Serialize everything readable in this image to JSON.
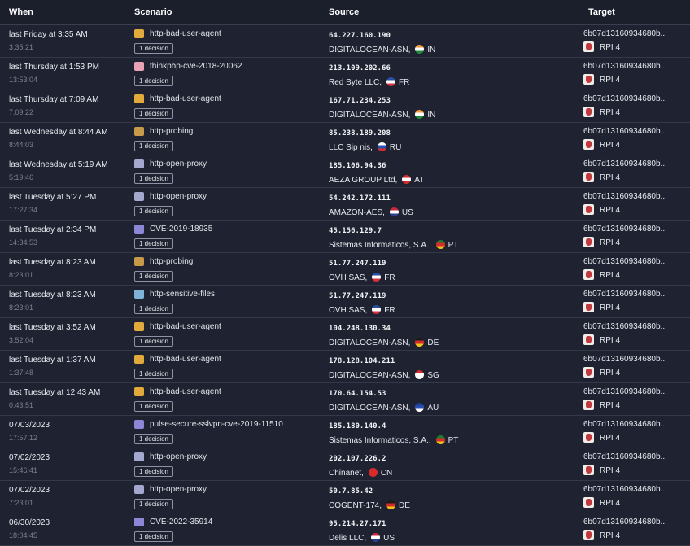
{
  "columns": {
    "when": "When",
    "scenario": "Scenario",
    "source": "Source",
    "target": "Target"
  },
  "rows": [
    {
      "when": "last Friday at 3:35 AM",
      "time": "3:35:21",
      "scenario": "http-bad-user-agent",
      "scen_color": "#e2a93b",
      "decision": "1 decision",
      "ip": "64.227.160.190",
      "asn": "DIGITALOCEAN-ASN,",
      "cc": "IN",
      "flag": [
        "#f49a3a",
        "#ffffff",
        "#1f8a3a"
      ],
      "target_id": "6b07d13160934680b...",
      "target_name": "RPI 4"
    },
    {
      "when": "last Thursday at 1:53 PM",
      "time": "13:53:04",
      "scenario": "thinkphp-cve-2018-20062",
      "scen_color": "#e9a1b5",
      "decision": "1 decision",
      "ip": "213.109.202.66",
      "asn": "Red Byte LLC,",
      "cc": "FR",
      "flag": [
        "#2a4ea1",
        "#ffffff",
        "#d8313b"
      ],
      "target_id": "6b07d13160934680b...",
      "target_name": "RPI 4"
    },
    {
      "when": "last Thursday at 7:09 AM",
      "time": "7:09:22",
      "scenario": "http-bad-user-agent",
      "scen_color": "#e2a93b",
      "decision": "1 decision",
      "ip": "167.71.234.253",
      "asn": "DIGITALOCEAN-ASN,",
      "cc": "IN",
      "flag": [
        "#f49a3a",
        "#ffffff",
        "#1f8a3a"
      ],
      "target_id": "6b07d13160934680b...",
      "target_name": "RPI 4"
    },
    {
      "when": "last Wednesday at 8:44 AM",
      "time": "8:44:03",
      "scenario": "http-probing",
      "scen_color": "#c79a4a",
      "decision": "1 decision",
      "ip": "85.238.189.208",
      "asn": "LLC Sip nis,",
      "cc": "RU",
      "flag": [
        "#ffffff",
        "#2b50b4",
        "#d52b2b"
      ],
      "target_id": "6b07d13160934680b...",
      "target_name": "RPI 4"
    },
    {
      "when": "last Wednesday at 5:19 AM",
      "time": "5:19:46",
      "scenario": "http-open-proxy",
      "scen_color": "#a4a8cf",
      "decision": "1 decision",
      "ip": "185.106.94.36",
      "asn": "AEZA GROUP Ltd,",
      "cc": "AT",
      "flag": [
        "#d52b2b",
        "#ffffff",
        "#d52b2b"
      ],
      "target_id": "6b07d13160934680b...",
      "target_name": "RPI 4"
    },
    {
      "when": "last Tuesday at 5:27 PM",
      "time": "17:27:34",
      "scenario": "http-open-proxy",
      "scen_color": "#a4a8cf",
      "decision": "1 decision",
      "ip": "54.242.172.111",
      "asn": "AMAZON-AES,",
      "cc": "US",
      "flag": [
        "#c9283a",
        "#ffffff",
        "#2c3e8f"
      ],
      "target_id": "6b07d13160934680b...",
      "target_name": "RPI 4"
    },
    {
      "when": "last Tuesday at 2:34 PM",
      "time": "14:34:53",
      "scenario": "CVE-2019-18935",
      "scen_color": "#8c86d6",
      "decision": "1 decision",
      "ip": "45.156.129.7",
      "asn": "Sistemas Informaticos, S.A.,",
      "cc": "PT",
      "flag": [
        "#1f7a30",
        "#d52b2b",
        "#f0c419"
      ],
      "target_id": "6b07d13160934680b...",
      "target_name": "RPI 4"
    },
    {
      "when": "last Tuesday at 8:23 AM",
      "time": "8:23:01",
      "scenario": "http-probing",
      "scen_color": "#c79a4a",
      "decision": "1 decision",
      "ip": "51.77.247.119",
      "asn": "OVH SAS,",
      "cc": "FR",
      "flag": [
        "#2a4ea1",
        "#ffffff",
        "#d8313b"
      ],
      "target_id": "6b07d13160934680b...",
      "target_name": "RPI 4"
    },
    {
      "when": "last Tuesday at 8:23 AM",
      "time": "8:23:01",
      "scenario": "http-sensitive-files",
      "scen_color": "#7fb2d8",
      "decision": "1 decision",
      "ip": "51.77.247.119",
      "asn": "OVH SAS,",
      "cc": "FR",
      "flag": [
        "#2a4ea1",
        "#ffffff",
        "#d8313b"
      ],
      "target_id": "6b07d13160934680b...",
      "target_name": "RPI 4"
    },
    {
      "when": "last Tuesday at 3:52 AM",
      "time": "3:52:04",
      "scenario": "http-bad-user-agent",
      "scen_color": "#e2a93b",
      "decision": "1 decision",
      "ip": "104.248.130.34",
      "asn": "DIGITALOCEAN-ASN,",
      "cc": "DE",
      "flag": [
        "#1a1a1a",
        "#d52b2b",
        "#f0c419"
      ],
      "target_id": "6b07d13160934680b...",
      "target_name": "RPI 4"
    },
    {
      "when": "last Tuesday at 1:37 AM",
      "time": "1:37:48",
      "scenario": "http-bad-user-agent",
      "scen_color": "#e2a93b",
      "decision": "1 decision",
      "ip": "178.128.104.211",
      "asn": "DIGITALOCEAN-ASN,",
      "cc": "SG",
      "flag": [
        "#d52b2b",
        "#ffffff",
        "#ffffff"
      ],
      "target_id": "6b07d13160934680b...",
      "target_name": "RPI 4"
    },
    {
      "when": "last Tuesday at 12:43 AM",
      "time": "0:43:51",
      "scenario": "http-bad-user-agent",
      "scen_color": "#e2a93b",
      "decision": "1 decision",
      "ip": "170.64.154.53",
      "asn": "DIGITALOCEAN-ASN,",
      "cc": "AU",
      "flag": [
        "#1f3d8f",
        "#2b50b4",
        "#ffffff"
      ],
      "target_id": "6b07d13160934680b...",
      "target_name": "RPI 4"
    },
    {
      "when": "07/03/2023",
      "time": "17:57:12",
      "scenario": "pulse-secure-sslvpn-cve-2019-11510",
      "scen_color": "#8c86d6",
      "decision": "1 decision",
      "ip": "185.180.140.4",
      "asn": "Sistemas Informaticos, S.A.,",
      "cc": "PT",
      "flag": [
        "#1f7a30",
        "#d52b2b",
        "#f0c419"
      ],
      "target_id": "6b07d13160934680b...",
      "target_name": "RPI 4"
    },
    {
      "when": "07/02/2023",
      "time": "15:46:41",
      "scenario": "http-open-proxy",
      "scen_color": "#a4a8cf",
      "decision": "1 decision",
      "ip": "202.107.226.2",
      "asn": "Chinanet,",
      "cc": "CN",
      "flag": [
        "#d52b2b",
        "#d52b2b",
        "#d52b2b"
      ],
      "target_id": "6b07d13160934680b...",
      "target_name": "RPI 4"
    },
    {
      "when": "07/02/2023",
      "time": "7:23:01",
      "scenario": "http-open-proxy",
      "scen_color": "#a4a8cf",
      "decision": "1 decision",
      "ip": "50.7.85.42",
      "asn": "COGENT-174,",
      "cc": "DE",
      "flag": [
        "#1a1a1a",
        "#d52b2b",
        "#f0c419"
      ],
      "target_id": "6b07d13160934680b...",
      "target_name": "RPI 4"
    },
    {
      "when": "06/30/2023",
      "time": "18:04:45",
      "scenario": "CVE-2022-35914",
      "scen_color": "#8c86d6",
      "decision": "1 decision",
      "ip": "95.214.27.171",
      "asn": "Delis LLC,",
      "cc": "US",
      "flag": [
        "#c9283a",
        "#ffffff",
        "#2c3e8f"
      ],
      "target_id": "6b07d13160934680b...",
      "target_name": "RPI 4"
    }
  ]
}
